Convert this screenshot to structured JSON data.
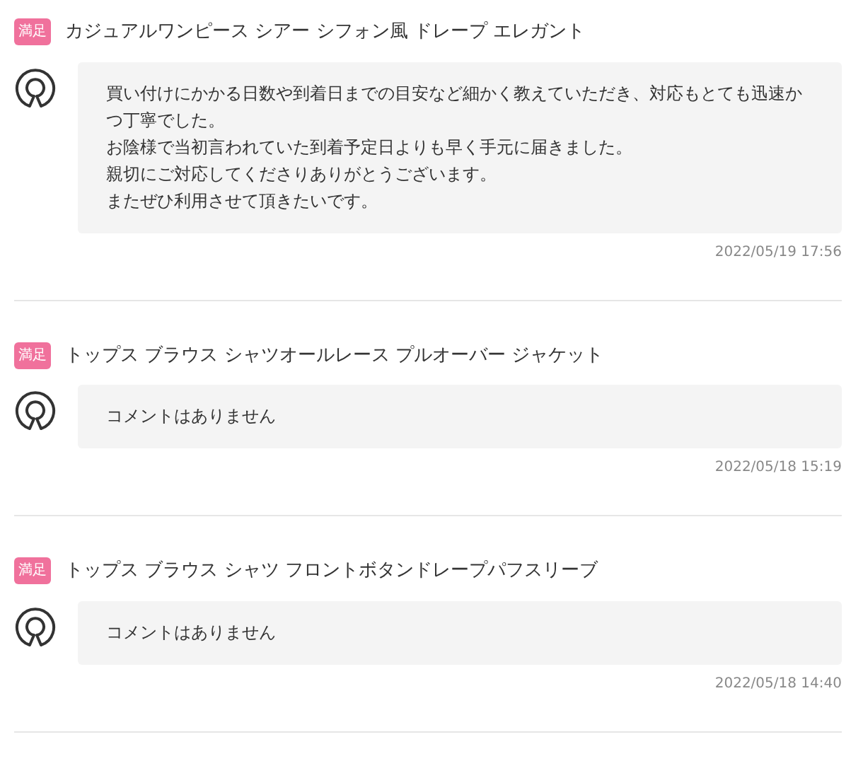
{
  "reviews": [
    {
      "badge": "満足",
      "title": "カジュアルワンピース シアー シフォン風 ドレープ エレガント",
      "comment": [
        "買い付けにかかる日数や到着日までの目安など細かく教えていただき、対応もとても迅速かつ丁寧でした。",
        "お陰様で当初言われていた到着予定日よりも早く手元に届きました。",
        "親切にご対応してくださりありがとうございます。",
        "またぜひ利用させて頂きたいです。"
      ],
      "date": "2022/05/19 17:56"
    },
    {
      "badge": "満足",
      "title": "トップス ブラウス シャツオールレース プルオーバー ジャケット",
      "comment": [
        "コメントはありません"
      ],
      "date": "2022/05/18 15:19"
    },
    {
      "badge": "満足",
      "title": "トップス ブラウス シャツ フロントボタンドレープパフスリーブ",
      "comment": [
        "コメントはありません"
      ],
      "date": "2022/05/18 14:40"
    }
  ]
}
